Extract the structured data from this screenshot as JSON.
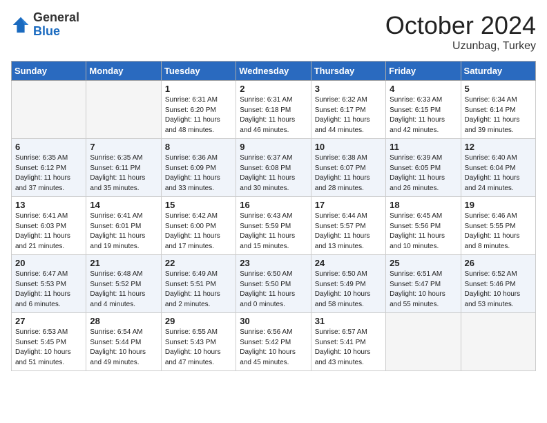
{
  "header": {
    "logo_general": "General",
    "logo_blue": "Blue",
    "month": "October 2024",
    "location": "Uzunbag, Turkey"
  },
  "weekdays": [
    "Sunday",
    "Monday",
    "Tuesday",
    "Wednesday",
    "Thursday",
    "Friday",
    "Saturday"
  ],
  "weeks": [
    [
      {
        "day": "",
        "details": ""
      },
      {
        "day": "",
        "details": ""
      },
      {
        "day": "1",
        "details": "Sunrise: 6:31 AM\nSunset: 6:20 PM\nDaylight: 11 hours and 48 minutes."
      },
      {
        "day": "2",
        "details": "Sunrise: 6:31 AM\nSunset: 6:18 PM\nDaylight: 11 hours and 46 minutes."
      },
      {
        "day": "3",
        "details": "Sunrise: 6:32 AM\nSunset: 6:17 PM\nDaylight: 11 hours and 44 minutes."
      },
      {
        "day": "4",
        "details": "Sunrise: 6:33 AM\nSunset: 6:15 PM\nDaylight: 11 hours and 42 minutes."
      },
      {
        "day": "5",
        "details": "Sunrise: 6:34 AM\nSunset: 6:14 PM\nDaylight: 11 hours and 39 minutes."
      }
    ],
    [
      {
        "day": "6",
        "details": "Sunrise: 6:35 AM\nSunset: 6:12 PM\nDaylight: 11 hours and 37 minutes."
      },
      {
        "day": "7",
        "details": "Sunrise: 6:35 AM\nSunset: 6:11 PM\nDaylight: 11 hours and 35 minutes."
      },
      {
        "day": "8",
        "details": "Sunrise: 6:36 AM\nSunset: 6:09 PM\nDaylight: 11 hours and 33 minutes."
      },
      {
        "day": "9",
        "details": "Sunrise: 6:37 AM\nSunset: 6:08 PM\nDaylight: 11 hours and 30 minutes."
      },
      {
        "day": "10",
        "details": "Sunrise: 6:38 AM\nSunset: 6:07 PM\nDaylight: 11 hours and 28 minutes."
      },
      {
        "day": "11",
        "details": "Sunrise: 6:39 AM\nSunset: 6:05 PM\nDaylight: 11 hours and 26 minutes."
      },
      {
        "day": "12",
        "details": "Sunrise: 6:40 AM\nSunset: 6:04 PM\nDaylight: 11 hours and 24 minutes."
      }
    ],
    [
      {
        "day": "13",
        "details": "Sunrise: 6:41 AM\nSunset: 6:03 PM\nDaylight: 11 hours and 21 minutes."
      },
      {
        "day": "14",
        "details": "Sunrise: 6:41 AM\nSunset: 6:01 PM\nDaylight: 11 hours and 19 minutes."
      },
      {
        "day": "15",
        "details": "Sunrise: 6:42 AM\nSunset: 6:00 PM\nDaylight: 11 hours and 17 minutes."
      },
      {
        "day": "16",
        "details": "Sunrise: 6:43 AM\nSunset: 5:59 PM\nDaylight: 11 hours and 15 minutes."
      },
      {
        "day": "17",
        "details": "Sunrise: 6:44 AM\nSunset: 5:57 PM\nDaylight: 11 hours and 13 minutes."
      },
      {
        "day": "18",
        "details": "Sunrise: 6:45 AM\nSunset: 5:56 PM\nDaylight: 11 hours and 10 minutes."
      },
      {
        "day": "19",
        "details": "Sunrise: 6:46 AM\nSunset: 5:55 PM\nDaylight: 11 hours and 8 minutes."
      }
    ],
    [
      {
        "day": "20",
        "details": "Sunrise: 6:47 AM\nSunset: 5:53 PM\nDaylight: 11 hours and 6 minutes."
      },
      {
        "day": "21",
        "details": "Sunrise: 6:48 AM\nSunset: 5:52 PM\nDaylight: 11 hours and 4 minutes."
      },
      {
        "day": "22",
        "details": "Sunrise: 6:49 AM\nSunset: 5:51 PM\nDaylight: 11 hours and 2 minutes."
      },
      {
        "day": "23",
        "details": "Sunrise: 6:50 AM\nSunset: 5:50 PM\nDaylight: 11 hours and 0 minutes."
      },
      {
        "day": "24",
        "details": "Sunrise: 6:50 AM\nSunset: 5:49 PM\nDaylight: 10 hours and 58 minutes."
      },
      {
        "day": "25",
        "details": "Sunrise: 6:51 AM\nSunset: 5:47 PM\nDaylight: 10 hours and 55 minutes."
      },
      {
        "day": "26",
        "details": "Sunrise: 6:52 AM\nSunset: 5:46 PM\nDaylight: 10 hours and 53 minutes."
      }
    ],
    [
      {
        "day": "27",
        "details": "Sunrise: 6:53 AM\nSunset: 5:45 PM\nDaylight: 10 hours and 51 minutes."
      },
      {
        "day": "28",
        "details": "Sunrise: 6:54 AM\nSunset: 5:44 PM\nDaylight: 10 hours and 49 minutes."
      },
      {
        "day": "29",
        "details": "Sunrise: 6:55 AM\nSunset: 5:43 PM\nDaylight: 10 hours and 47 minutes."
      },
      {
        "day": "30",
        "details": "Sunrise: 6:56 AM\nSunset: 5:42 PM\nDaylight: 10 hours and 45 minutes."
      },
      {
        "day": "31",
        "details": "Sunrise: 6:57 AM\nSunset: 5:41 PM\nDaylight: 10 hours and 43 minutes."
      },
      {
        "day": "",
        "details": ""
      },
      {
        "day": "",
        "details": ""
      }
    ]
  ]
}
